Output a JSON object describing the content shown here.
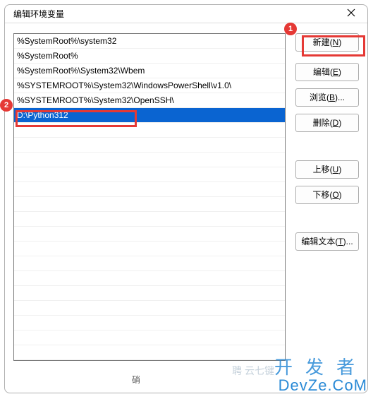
{
  "window": {
    "title": "编辑环境变量"
  },
  "list": {
    "items": [
      "%SystemRoot%\\system32",
      "%SystemRoot%",
      "%SystemRoot%\\System32\\Wbem",
      "%SYSTEMROOT%\\System32\\WindowsPowerShell\\v1.0\\",
      "%SYSTEMROOT%\\System32\\OpenSSH\\",
      "D:\\Python312"
    ],
    "selected_index": 5
  },
  "buttons": {
    "new": {
      "label": "新建",
      "accel": "N"
    },
    "edit": {
      "label": "编辑",
      "accel": "E"
    },
    "browse": {
      "label": "浏览",
      "accel": "B",
      "suffix": "..."
    },
    "delete": {
      "label": "删除",
      "accel": "D"
    },
    "moveup": {
      "label": "上移",
      "accel": "U"
    },
    "movedown": {
      "label": "下移",
      "accel": "O"
    },
    "edittext": {
      "label": "编辑文本",
      "accel": "T",
      "suffix": "..."
    }
  },
  "footer": {
    "ok_partial": "硝"
  },
  "annotations": {
    "circle1": "1",
    "circle2": "2"
  },
  "watermark": {
    "line1": "开发者",
    "line2": "DevZe.CoM",
    "faint": "聘 云七键"
  }
}
